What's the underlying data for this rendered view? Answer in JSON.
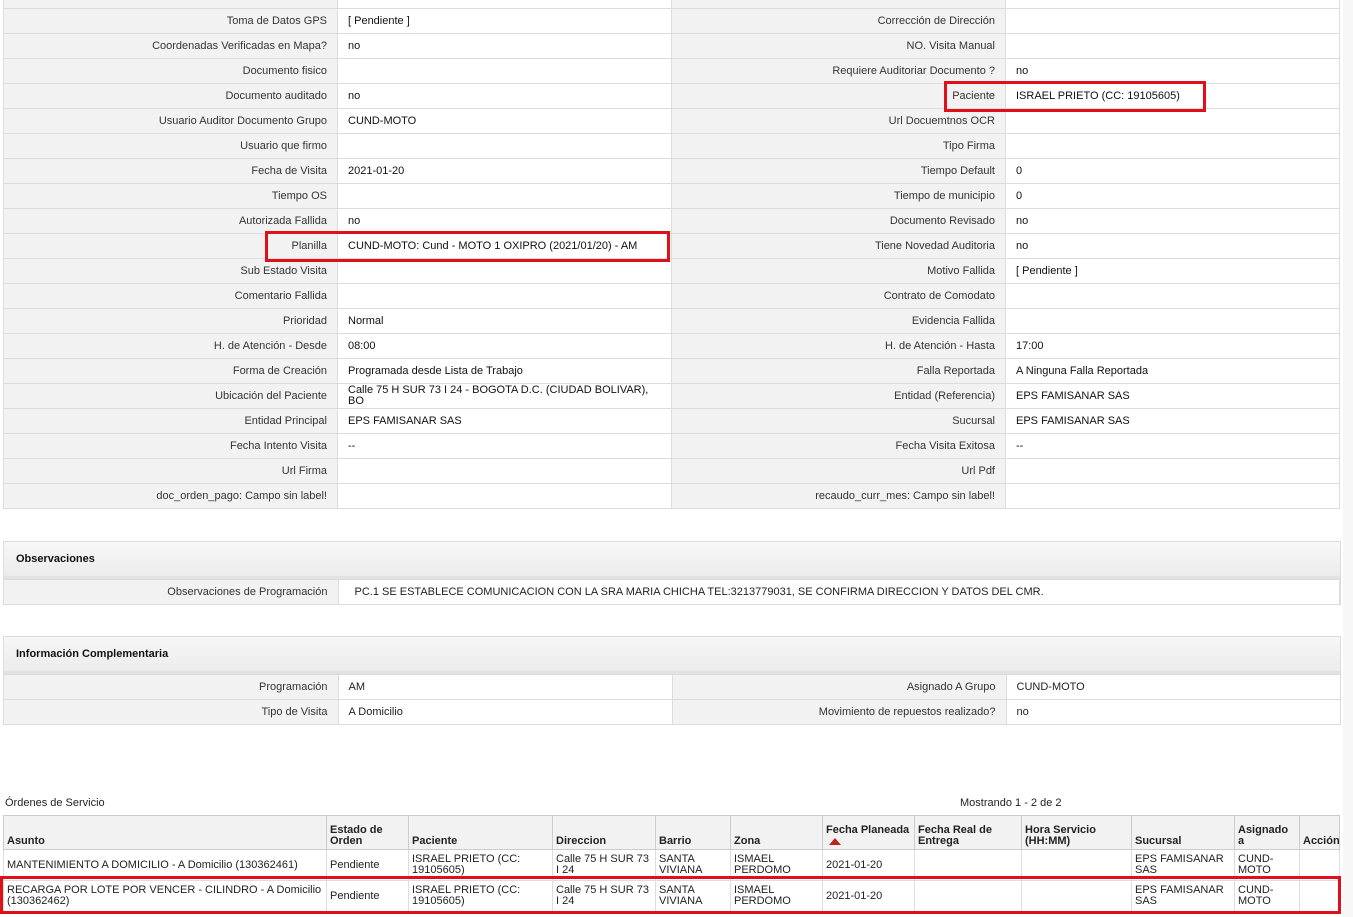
{
  "detail_rows": [
    {
      "l1": "Toma de Datos GPS",
      "v1": "[ Pendiente ]",
      "l2": "Corrección de Dirección",
      "v2": ""
    },
    {
      "l1": "Coordenadas Verificadas en Mapa?",
      "v1": "no",
      "l2": "NO. Visita Manual",
      "v2": ""
    },
    {
      "l1": "Documento fisico",
      "v1": "",
      "l2": "Requiere Auditoriar Documento ?",
      "v2": "no"
    },
    {
      "l1": "Documento auditado",
      "v1": "no",
      "l2": "Paciente",
      "v2": "ISRAEL PRIETO (CC: 19105605)"
    },
    {
      "l1": "Usuario Auditor Documento Grupo",
      "v1": "CUND-MOTO",
      "l2": "Url Docuemtnos OCR",
      "v2": ""
    },
    {
      "l1": "Usuario que firmo",
      "v1": "",
      "l2": "Tipo Firma",
      "v2": ""
    },
    {
      "l1": "Fecha de Visita",
      "v1": "2021-01-20",
      "l2": "Tiempo Default",
      "v2": "0"
    },
    {
      "l1": "Tiempo OS",
      "v1": "",
      "l2": "Tiempo de municipio",
      "v2": "0"
    },
    {
      "l1": "Autorizada Fallida",
      "v1": "no",
      "l2": "Documento Revisado",
      "v2": "no"
    },
    {
      "l1": "Planilla",
      "v1": "CUND-MOTO: Cund - MOTO 1 OXIPRO (2021/01/20) - AM",
      "l2": "Tiene Novedad Auditoria",
      "v2": "no"
    },
    {
      "l1": "Sub Estado Visita",
      "v1": "",
      "l2": "Motivo Fallida",
      "v2": "[ Pendiente ]"
    },
    {
      "l1": "Comentario Fallida",
      "v1": "",
      "l2": "Contrato de Comodato",
      "v2": ""
    },
    {
      "l1": "Prioridad",
      "v1": "Normal",
      "l2": "Evidencia Fallida",
      "v2": ""
    },
    {
      "l1": "H. de Atención - Desde",
      "v1": "08:00",
      "l2": "H. de Atención - Hasta",
      "v2": "17:00"
    },
    {
      "l1": "Forma de Creación",
      "v1": "Programada desde Lista de Trabajo",
      "l2": "Falla Reportada",
      "v2": "A Ninguna Falla Reportada"
    },
    {
      "l1": "Ubicación del Paciente",
      "v1": "Calle 75 H SUR 73 I 24 - BOGOTA D.C. (CIUDAD BOLIVAR), BO",
      "l2": "Entidad (Referencia)",
      "v2": "EPS FAMISANAR SAS"
    },
    {
      "l1": "Entidad Principal",
      "v1": "EPS FAMISANAR SAS",
      "l2": "Sucursal",
      "v2": "EPS FAMISANAR SAS"
    },
    {
      "l1": "Fecha Intento Visita",
      "v1": "--",
      "l2": "Fecha Visita Exitosa",
      "v2": "--"
    },
    {
      "l1": "Url Firma",
      "v1": "",
      "l2": "Url Pdf",
      "v2": ""
    },
    {
      "l1": "doc_orden_pago: Campo sin label!",
      "v1": "",
      "l2": "recaudo_curr_mes: Campo sin label!",
      "v2": ""
    }
  ],
  "observaciones": {
    "title": "Observaciones",
    "label": "Observaciones de Programación",
    "value": "PC.1 SE ESTABLECE COMUNICACION CON LA SRA MARIA CHICHA TEL:3213779031, SE CONFIRMA DIRECCION Y DATOS DEL CMR."
  },
  "complementaria": {
    "title": "Información Complementaria",
    "rows": [
      {
        "l1": "Programación",
        "v1": "AM",
        "l2": "Asignado A Grupo",
        "v2": "CUND-MOTO"
      },
      {
        "l1": "Tipo de Visita",
        "v1": "A Domicilio",
        "l2": "Movimiento de repuestos realizado?",
        "v2": "no"
      }
    ]
  },
  "ordenes": {
    "title": "Órdenes de Servicio",
    "count_text": "Mostrando 1 - 2 de 2",
    "columns": [
      "Asunto",
      "Estado de Orden",
      "Paciente",
      "Direccion",
      "Barrio",
      "Zona",
      "Fecha Planeada",
      "Fecha Real de Entrega",
      "Hora Servicio (HH:MM)",
      "Sucursal",
      "Asignado a",
      "Acción"
    ],
    "rows": [
      [
        "MANTENIMIENTO A DOMICILIO - A Domicilio (130362461)",
        "Pendiente",
        "ISRAEL PRIETO (CC: 19105605)",
        "Calle 75 H SUR 73 I 24",
        "SANTA VIVIANA",
        "ISMAEL PERDOMO",
        "2021-01-20",
        "",
        "",
        "EPS FAMISANAR SAS",
        "CUND-MOTO",
        ""
      ],
      [
        "RECARGA POR LOTE POR VENCER - CILINDRO - A Domicilio (130362462)",
        "Pendiente",
        "ISRAEL PRIETO (CC: 19105605)",
        "Calle 75 H SUR 73 I 24",
        "SANTA VIVIANA",
        "ISMAEL PERDOMO",
        "2021-01-20",
        "",
        "",
        "EPS FAMISANAR SAS",
        "CUND-MOTO",
        ""
      ]
    ]
  },
  "colors": {
    "highlight": "#e0101a",
    "label_bg": "#f2f2f2",
    "sort_arrow": "#b22222"
  }
}
